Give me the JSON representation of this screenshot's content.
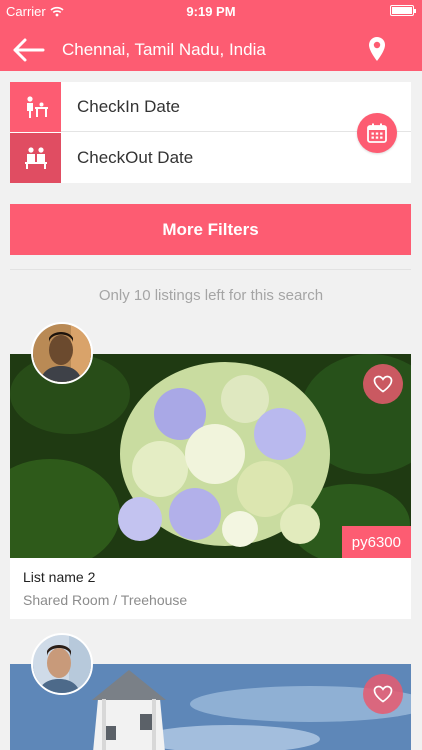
{
  "status_bar": {
    "carrier": "Carrier",
    "time": "9:19 PM"
  },
  "header": {
    "location": "Chennai, Tamil Nadu, India",
    "back_icon": "arrow-left-icon",
    "location_icon": "map-pin-icon"
  },
  "dates": {
    "checkin_label": "CheckIn Date",
    "checkout_label": "CheckOut Date",
    "calendar_icon": "calendar-icon"
  },
  "filters": {
    "label": "More Filters"
  },
  "listings_note": "Only 10 listings left for this search",
  "listings": [
    {
      "name": "List name 2",
      "type": "Shared Room / Treehouse",
      "price": "py6300",
      "favorite_icon": "heart-icon"
    },
    {
      "favorite_icon": "heart-icon"
    }
  ],
  "colors": {
    "accent": "#fd5c72",
    "accent_dark": "#e04d62"
  }
}
